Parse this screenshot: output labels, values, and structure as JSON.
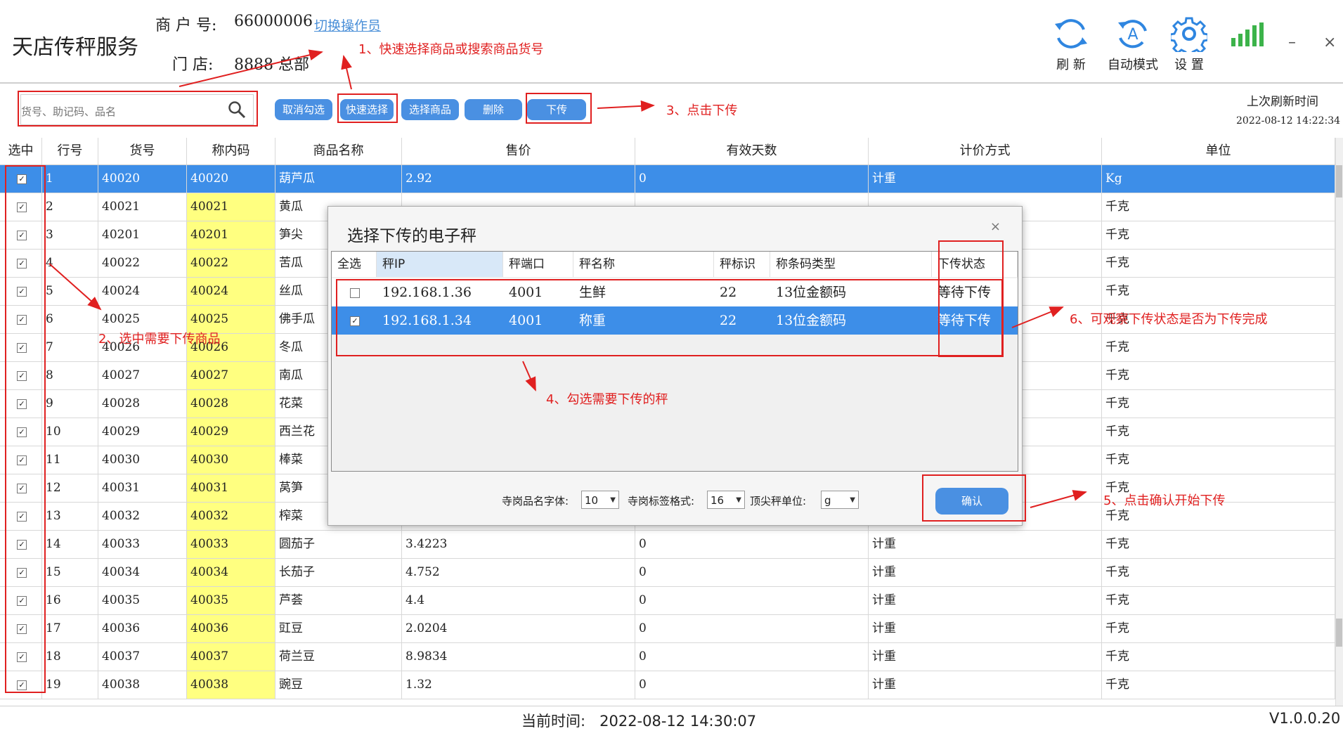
{
  "header": {
    "app_title": "天店传秤服务",
    "merchant_label": "商 户 号:",
    "merchant_value": "66000006",
    "switch_operator": "切换操作员",
    "store_label": "门 店:",
    "store_value": "8888 总部",
    "tools": [
      {
        "label": "刷 新",
        "icon": "refresh-icon"
      },
      {
        "label": "自动模式",
        "icon": "auto-mode-icon"
      },
      {
        "label": "设 置",
        "icon": "gear-icon"
      }
    ],
    "signal_icon": "signal-bars-icon",
    "minimize": "–",
    "close": "×"
  },
  "toolbar": {
    "search_placeholder": "货号、助记码、品名",
    "buttons": [
      "取消勾选",
      "快速选择",
      "选择商品",
      "删除",
      "下传"
    ],
    "last_refresh_label": "上次刷新时间",
    "last_refresh_value": "2022-08-12 14:22:34"
  },
  "grid": {
    "columns": [
      "选中",
      "行号",
      "货号",
      "称内码",
      "商品名称",
      "售价",
      "有效天数",
      "计价方式",
      "单位"
    ],
    "rows": [
      {
        "no": "1",
        "code": "40020",
        "plu": "40020",
        "name": "葫芦瓜",
        "price": "2.92",
        "days": "0",
        "mode": "计重",
        "unit": "Kg",
        "selected": true
      },
      {
        "no": "2",
        "code": "40021",
        "plu": "40021",
        "name": "黄瓜",
        "price": "",
        "days": "",
        "mode": "",
        "unit": "千克"
      },
      {
        "no": "3",
        "code": "40201",
        "plu": "40201",
        "name": "笋尖",
        "price": "",
        "days": "",
        "mode": "",
        "unit": "千克"
      },
      {
        "no": "4",
        "code": "40022",
        "plu": "40022",
        "name": "苦瓜",
        "price": "",
        "days": "",
        "mode": "",
        "unit": "千克"
      },
      {
        "no": "5",
        "code": "40024",
        "plu": "40024",
        "name": "丝瓜",
        "price": "",
        "days": "",
        "mode": "",
        "unit": "千克"
      },
      {
        "no": "6",
        "code": "40025",
        "plu": "40025",
        "name": "佛手瓜",
        "price": "",
        "days": "",
        "mode": "",
        "unit": "千克"
      },
      {
        "no": "7",
        "code": "40026",
        "plu": "40026",
        "name": "冬瓜",
        "price": "",
        "days": "",
        "mode": "",
        "unit": "千克"
      },
      {
        "no": "8",
        "code": "40027",
        "plu": "40027",
        "name": "南瓜",
        "price": "",
        "days": "",
        "mode": "",
        "unit": "千克"
      },
      {
        "no": "9",
        "code": "40028",
        "plu": "40028",
        "name": "花菜",
        "price": "",
        "days": "",
        "mode": "",
        "unit": "千克"
      },
      {
        "no": "10",
        "code": "40029",
        "plu": "40029",
        "name": "西兰花",
        "price": "",
        "days": "",
        "mode": "",
        "unit": "千克"
      },
      {
        "no": "11",
        "code": "40030",
        "plu": "40030",
        "name": "棒菜",
        "price": "",
        "days": "",
        "mode": "",
        "unit": "千克"
      },
      {
        "no": "12",
        "code": "40031",
        "plu": "40031",
        "name": "莴笋",
        "price": "",
        "days": "",
        "mode": "",
        "unit": "千克"
      },
      {
        "no": "13",
        "code": "40032",
        "plu": "40032",
        "name": "榨菜",
        "price": "",
        "days": "",
        "mode": "",
        "unit": "千克"
      },
      {
        "no": "14",
        "code": "40033",
        "plu": "40033",
        "name": "圆茄子",
        "price": "3.4223",
        "days": "0",
        "mode": "计重",
        "unit": "千克"
      },
      {
        "no": "15",
        "code": "40034",
        "plu": "40034",
        "name": "长茄子",
        "price": "4.752",
        "days": "0",
        "mode": "计重",
        "unit": "千克"
      },
      {
        "no": "16",
        "code": "40035",
        "plu": "40035",
        "name": "芦荟",
        "price": "4.4",
        "days": "0",
        "mode": "计重",
        "unit": "千克"
      },
      {
        "no": "17",
        "code": "40036",
        "plu": "40036",
        "name": "豇豆",
        "price": "2.0204",
        "days": "0",
        "mode": "计重",
        "unit": "千克"
      },
      {
        "no": "18",
        "code": "40037",
        "plu": "40037",
        "name": "荷兰豆",
        "price": "8.9834",
        "days": "0",
        "mode": "计重",
        "unit": "千克"
      },
      {
        "no": "19",
        "code": "40038",
        "plu": "40038",
        "name": "豌豆",
        "price": "1.32",
        "days": "0",
        "mode": "计重",
        "unit": "千克"
      }
    ]
  },
  "footer": {
    "current_time_label": "当前时间:",
    "current_time_value": "2022-08-12 14:30:07",
    "version": "V1.0.0.20"
  },
  "dialog": {
    "title": "选择下传的电子秤",
    "close": "×",
    "columns": [
      "全选",
      "秤IP",
      "秤端口",
      "秤名称",
      "秤标识",
      "称条码类型",
      "下传状态"
    ],
    "rows": [
      {
        "ip": "192.168.1.36",
        "port": "4001",
        "name": "生鲜",
        "id": "22",
        "barcode": "13位金额码",
        "status": "等待下传",
        "checked": false
      },
      {
        "ip": "192.168.1.34",
        "port": "4001",
        "name": "称重",
        "id": "22",
        "barcode": "13位金额码",
        "status": "等待下传",
        "checked": true
      }
    ],
    "options": [
      {
        "label": "寺岗品名字体:",
        "value": "10"
      },
      {
        "label": "寺岗标签格式:",
        "value": "16"
      },
      {
        "label": "顶尖秤单位:",
        "value": "g"
      }
    ],
    "confirm": "确认"
  },
  "annotations": [
    "1、快速选择商品或搜索商品货号",
    "2、选中需要下传商品",
    "3、点击下传",
    "4、勾选需要下传的秤",
    "5、点击确认开始下传",
    "6、可观察下传状态是否为下传完成"
  ],
  "colors": {
    "accent": "#4a90e2",
    "selected_row": "#3d8ee8",
    "plu_highlight": "#ffff80",
    "annotation": "#e02020",
    "signal": "#3cb34a"
  }
}
